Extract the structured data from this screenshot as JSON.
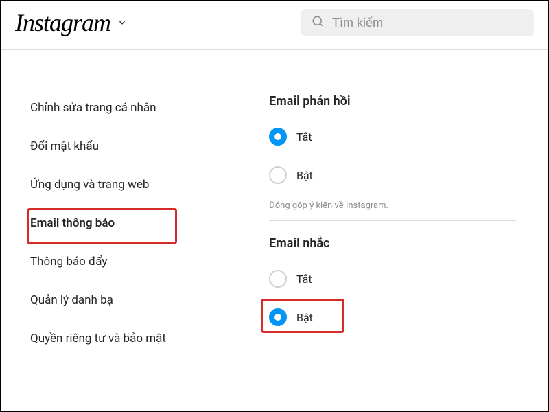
{
  "header": {
    "logo": "Instagram",
    "search_placeholder": "Tìm kiếm"
  },
  "sidebar": {
    "items": [
      {
        "label": "Chỉnh sửa trang cá nhân"
      },
      {
        "label": "Đổi mật khẩu"
      },
      {
        "label": "Ứng dụng và trang web"
      },
      {
        "label": "Email thông báo"
      },
      {
        "label": "Thông báo đẩy"
      },
      {
        "label": "Quản lý danh bạ"
      },
      {
        "label": "Quyền riêng tư và bảo mật"
      }
    ]
  },
  "main": {
    "section1": {
      "title": "Email phản hồi",
      "option_off": "Tắt",
      "option_on": "Bật",
      "description": "Đóng góp ý kiến về Instagram."
    },
    "section2": {
      "title": "Email nhắc",
      "option_off": "Tắt",
      "option_on": "Bật"
    }
  },
  "colors": {
    "accent": "#0095f6",
    "highlight": "#d52b2b"
  }
}
